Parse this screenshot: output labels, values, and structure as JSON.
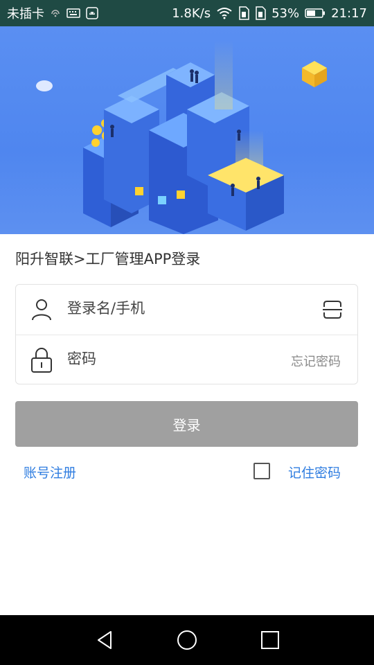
{
  "status_bar": {
    "carrier": "未插卡",
    "speed": "1.8K/s",
    "battery": "53%",
    "time": "21:17",
    "icons": [
      "hotspot-icon",
      "keyboard-icon",
      "android-icon",
      "wifi-icon",
      "sim1-icon",
      "sim2-icon",
      "battery-icon"
    ]
  },
  "login": {
    "title": "阳升智联>工厂管理APP登录",
    "username_placeholder": "登录名/手机",
    "password_placeholder": "密码",
    "forgot_password": "忘记密码",
    "login_button": "登录",
    "register": "账号注册",
    "remember_password": "记住密码",
    "remember_checked": false
  },
  "colors": {
    "status_bar_bg": "#1f4a44",
    "banner_bg": "#5a8ff2",
    "button_disabled": "#a0a0a0",
    "link_blue": "#2f7de0"
  },
  "nav": {
    "icons": [
      "back-icon",
      "home-icon",
      "recents-icon"
    ]
  }
}
